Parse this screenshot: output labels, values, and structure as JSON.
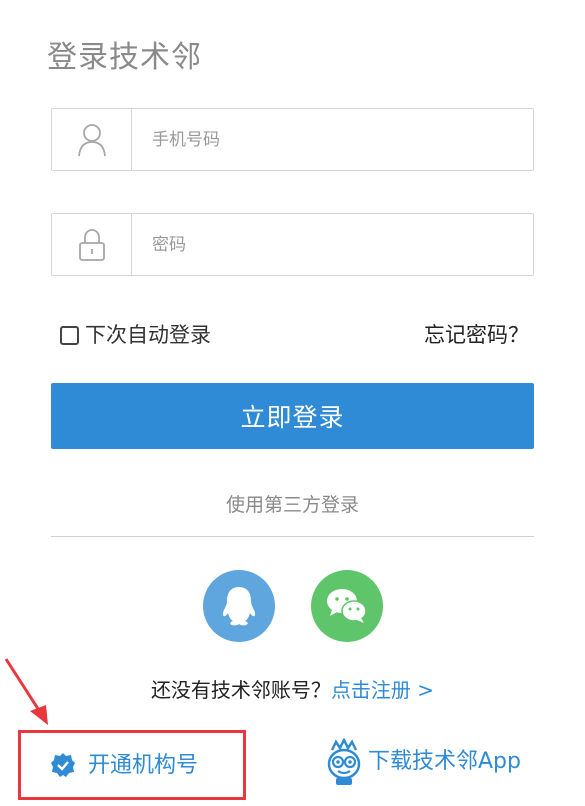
{
  "title": "登录技术邻",
  "phone_field": {
    "placeholder": "手机号码",
    "icon": "user-icon"
  },
  "password_field": {
    "placeholder": "密码",
    "icon": "lock-icon"
  },
  "remember": {
    "label": "下次自动登录",
    "checked": false
  },
  "forgot_link": "忘记密码？",
  "login_button": "立即登录",
  "third_party": {
    "label": "使用第三方登录",
    "providers": [
      {
        "icon": "qq-icon"
      },
      {
        "icon": "wechat-icon"
      }
    ]
  },
  "register": {
    "prompt": "还没有技术邻账号？",
    "link": "点击注册 >"
  },
  "footer": {
    "org_account": "开通机构号",
    "download_app": "下载技术邻App"
  },
  "colors": {
    "accent": "#2f8bd6",
    "qq": "#5ea6dd",
    "wechat": "#5fc56b",
    "highlight": "#e8383d"
  }
}
